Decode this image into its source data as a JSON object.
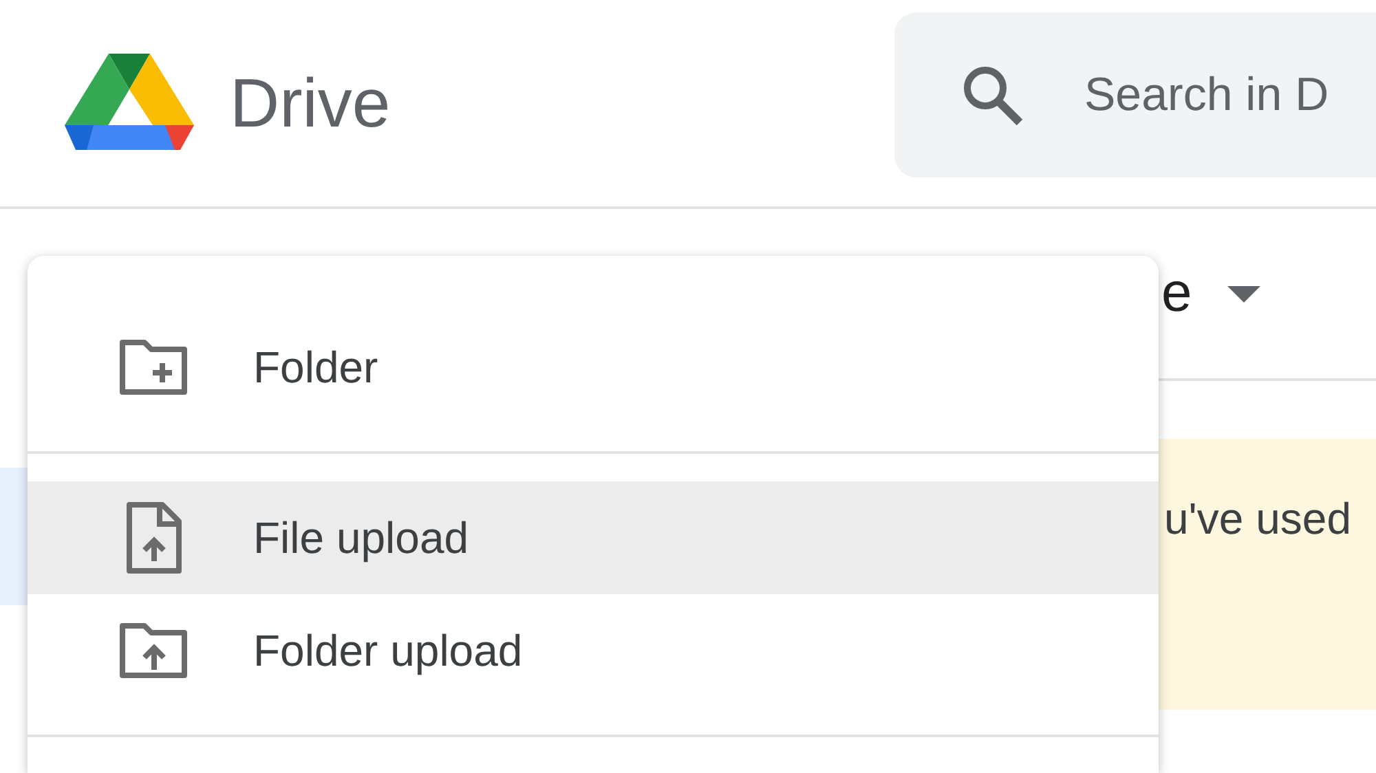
{
  "app": {
    "name": "Drive"
  },
  "search": {
    "placeholder": "Search in D"
  },
  "page_heading": {
    "title": "e"
  },
  "banner": {
    "text": "u've used"
  },
  "new_menu": {
    "items": [
      {
        "label": "Folder",
        "kind": "folder",
        "selected": false,
        "divider_after": true
      },
      {
        "label": "File upload",
        "kind": "file-upload",
        "selected": true,
        "divider_after": false
      },
      {
        "label": "Folder upload",
        "kind": "folder-upload",
        "selected": false,
        "divider_after": true
      }
    ]
  }
}
